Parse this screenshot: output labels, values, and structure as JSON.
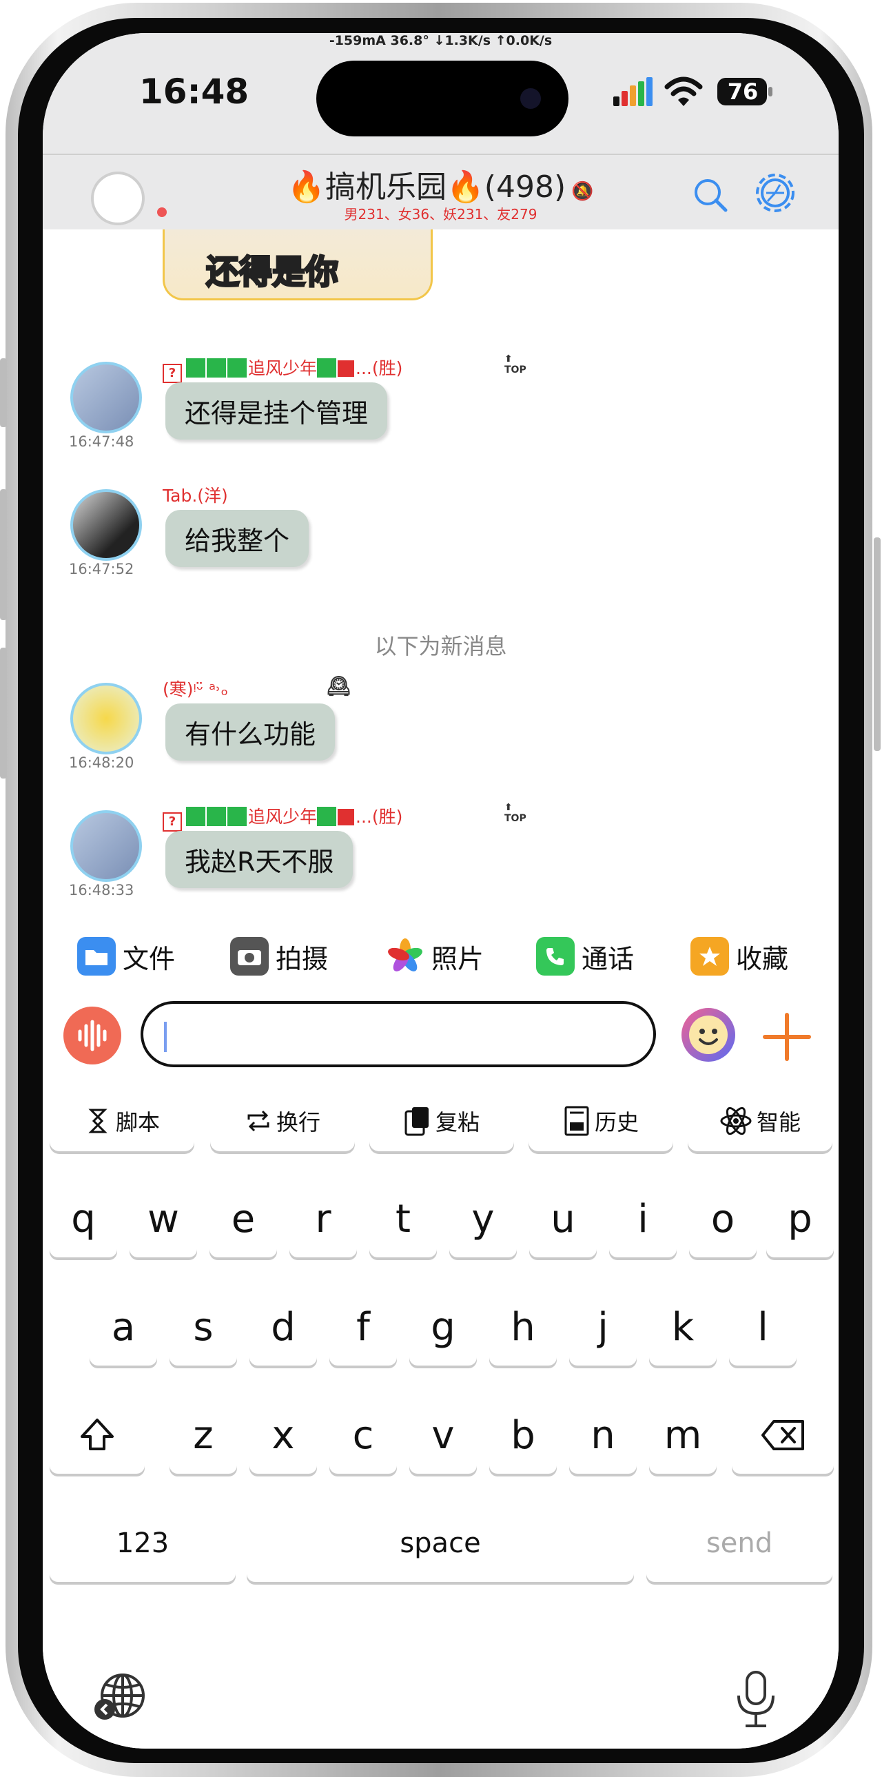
{
  "status": {
    "top_info": "-159mA  36.8°  ↓1.3K/s ↑0.0K/s",
    "time": "16:48",
    "battery": "76"
  },
  "header": {
    "title": "🔥搞机乐园🔥(498)",
    "subtitle": "男231、女36、妖231、友279"
  },
  "chat": {
    "sticker_text": "还得是你",
    "divider": "以下为新消息",
    "messages": [
      {
        "name": "...(胜)",
        "name_mid": "追风少年",
        "text": "还得是挂个管理",
        "time": "16:47:48"
      },
      {
        "name": "Tab.(洋)",
        "text": "给我整个",
        "time": "16:47:52"
      },
      {
        "name": "(寒)ᵎᵕ̈ ᵃ˒ₒ",
        "text": "有什么功能",
        "time": "16:48:20"
      },
      {
        "name": "...(胜)",
        "name_mid": "追风少年",
        "text": "我赵R天不服",
        "time": "16:48:33"
      }
    ]
  },
  "tools": [
    {
      "label": "文件",
      "icon": "folder-icon",
      "color": "#3b8ef0"
    },
    {
      "label": "拍摄",
      "icon": "camera-icon",
      "color": "#444444"
    },
    {
      "label": "照片",
      "icon": "photos-icon",
      "color": "#f0a030"
    },
    {
      "label": "通话",
      "icon": "phone-icon",
      "color": "#34c759"
    },
    {
      "label": "收藏",
      "icon": "star-icon",
      "color": "#f5a623"
    }
  ],
  "keyboard": {
    "func_keys": [
      "脚本",
      "换行",
      "复粘",
      "历史",
      "智能"
    ],
    "row1": [
      "q",
      "w",
      "e",
      "r",
      "t",
      "y",
      "u",
      "i",
      "o",
      "p"
    ],
    "row2": [
      "a",
      "s",
      "d",
      "f",
      "g",
      "h",
      "j",
      "k",
      "l"
    ],
    "row3": [
      "z",
      "x",
      "c",
      "v",
      "b",
      "n",
      "m"
    ],
    "num_label": "123",
    "space_label": "space",
    "send_label": "send"
  }
}
